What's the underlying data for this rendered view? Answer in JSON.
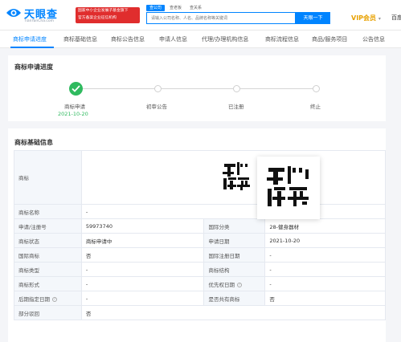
{
  "header": {
    "logo_cn": "天眼查",
    "logo_en": "TianYanCha.com",
    "banner_line1": "国家中小企业发展子基金旗下",
    "banner_line2": "官方备案企业征信机构",
    "search_tabs": [
      "查公司",
      "查老板",
      "查关系"
    ],
    "search_placeholder": "请输入公司名称、人名、品牌名称等关键词",
    "search_button": "天眼一下",
    "vip_label": "VIP会员",
    "vip_arrow": "▾",
    "extra_label": "百度"
  },
  "nav": {
    "items": [
      "商标申请进度",
      "商标基础信息",
      "商标公告信息",
      "申请人信息",
      "代理/办理机构信息",
      "商标流程信息",
      "商品/服务项目",
      "公告信息"
    ]
  },
  "progress": {
    "title": "商标申请进度",
    "steps": [
      {
        "label": "商标申请",
        "date": "2021-10-20",
        "done": true
      },
      {
        "label": "初审公告",
        "done": false
      },
      {
        "label": "已注册",
        "done": false
      },
      {
        "label": "终止",
        "done": false
      }
    ]
  },
  "basic_info": {
    "title": "商标基础信息",
    "trademark_label": "商标",
    "rows": [
      {
        "k1": "商标名称",
        "v1": "-"
      },
      {
        "k1": "申请/注册号",
        "v1": "59973740",
        "k2": "国际分类",
        "v2": "28-健身器材"
      },
      {
        "k1": "商标状态",
        "v1": "商标申请中",
        "k2": "申请日期",
        "v2": "2021-10-20"
      },
      {
        "k1": "国际商标",
        "v1": "否",
        "k2": "国际注册日期",
        "v2": "-"
      },
      {
        "k1": "商标类型",
        "v1": "-",
        "k2": "商标结构",
        "v2": "-"
      },
      {
        "k1": "商标形式",
        "v1": "-",
        "k2": "优先权日期",
        "v2": "-"
      },
      {
        "k1": "后期指定日期",
        "v1": "-",
        "k2": "是否共有商标",
        "v2": "否"
      },
      {
        "k1": "部分驳回",
        "v1": "否"
      }
    ]
  },
  "colors": {
    "brand": "#0084ff",
    "success": "#2fba5f",
    "vip": "#e8a100",
    "banner": "#e02d2d"
  }
}
